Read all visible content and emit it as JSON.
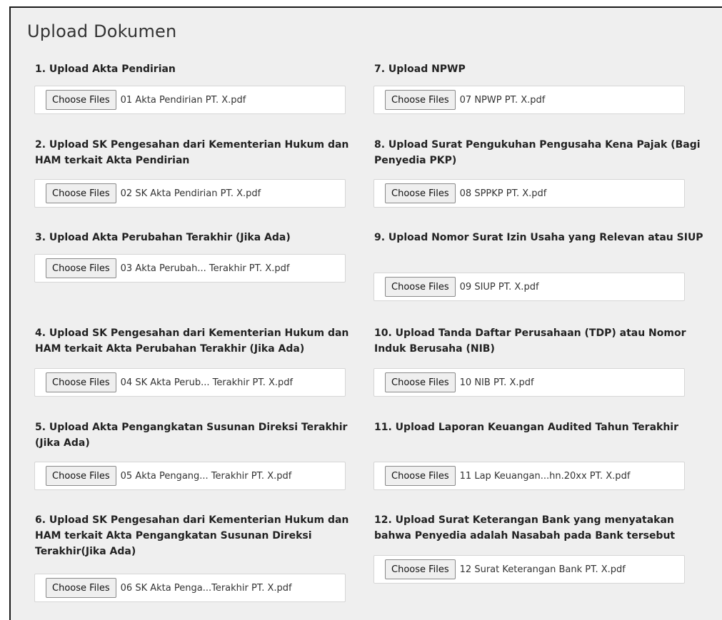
{
  "page": {
    "title": "Upload Dokumen"
  },
  "button_label": "Choose Files",
  "uploads": [
    {
      "label": "1. Upload Akta Pendirian",
      "file": "01 Akta Pendirian PT. X.pdf"
    },
    {
      "label": "2. Upload SK Pengesahan dari Kementerian Hukum dan HAM terkait Akta Pendirian",
      "file": "02 SK Akta Pendirian PT. X.pdf"
    },
    {
      "label": "3. Upload Akta Perubahan Terakhir (Jika Ada)",
      "file": "03 Akta Perubah... Terakhir PT. X.pdf"
    },
    {
      "label": "4. Upload SK Pengesahan dari Kementerian Hukum dan HAM terkait Akta Perubahan Terakhir (Jika Ada)",
      "file": "04 SK Akta Perub... Terakhir PT. X.pdf"
    },
    {
      "label": "5. Upload Akta Pengangkatan Susunan Direksi Terakhir (Jika Ada)",
      "file": "05 Akta Pengang... Terakhir PT. X.pdf"
    },
    {
      "label": "6. Upload SK Pengesahan dari Kementerian Hukum dan HAM terkait Akta Pengangkatan Susunan Direksi Terakhir(Jika Ada)",
      "file": "06 SK Akta Penga...Terakhir PT. X.pdf"
    },
    {
      "label": "7. Upload NPWP",
      "file": "07 NPWP PT. X.pdf"
    },
    {
      "label": "8. Upload Surat Pengukuhan Pengusaha Kena Pajak (Bagi Penyedia PKP)",
      "file": "08 SPPKP PT. X.pdf"
    },
    {
      "label": "9. Upload Nomor Surat Izin Usaha yang Relevan atau SIUP",
      "file": "09 SIUP PT. X.pdf"
    },
    {
      "label": "10. Upload Tanda Daftar Perusahaan (TDP) atau Nomor Induk Berusaha (NIB)",
      "file": "10 NIB PT. X.pdf"
    },
    {
      "label": "11. Upload Laporan Keuangan Audited Tahun Terakhir",
      "file": "11 Lap Keuangan...hn.20xx PT. X.pdf"
    },
    {
      "label": "12. Upload Surat Keterangan Bank yang menyatakan bahwa Penyedia adalah Nasabah pada Bank tersebut",
      "file": "12 Surat Keterangan Bank PT. X.pdf"
    }
  ]
}
